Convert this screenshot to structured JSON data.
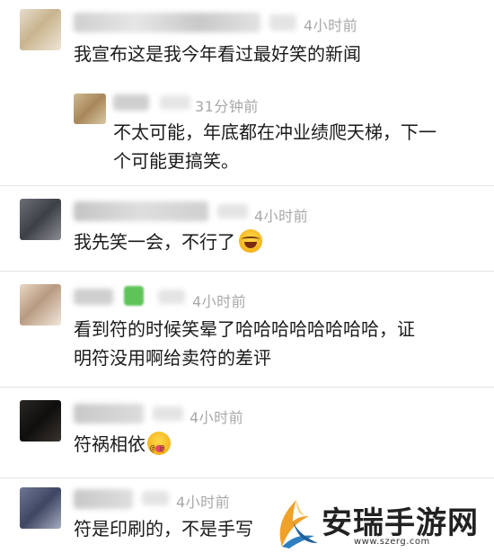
{
  "comments": [
    {
      "time": "4小时前",
      "text": "我宣布这是我今年看过最好笑的新闻",
      "reply": {
        "time": "31分钟前",
        "text_line1": "不太可能，年底都在冲业绩爬天梯，下一",
        "text_line2": "个可能更搞笑。"
      }
    },
    {
      "time": "4小时前",
      "text": "我先笑一会，不行了",
      "emoji": "laughing-crying-emoji"
    },
    {
      "time": "4小时前",
      "text_line1": "看到符的时候笑晕了哈哈哈哈哈哈哈哈，证",
      "text_line2": "明符没用啊给卖符的差评"
    },
    {
      "time": "4小时前",
      "text": "符祸相依",
      "emoji": "dizzy-face-emoji"
    },
    {
      "time": "4小时前",
      "text": "符是印刷的，不是手写"
    }
  ],
  "watermark": {
    "title": "安瑞手游网",
    "url": "www.szerg.com"
  },
  "colors": {
    "time_gray": "#a8a8a8",
    "divider": "#e3e3e3",
    "text": "#1b1b1b"
  }
}
